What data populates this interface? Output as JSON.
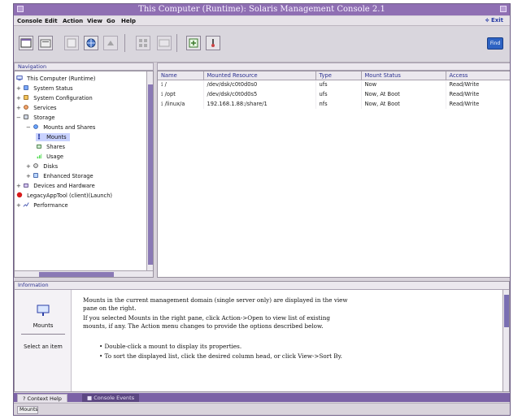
{
  "window": {
    "title": "This Computer (Runtime): Solaris Management Console 2.1"
  },
  "menu": {
    "items": [
      "Console",
      "Edit",
      "Action",
      "View",
      "Go",
      "Help"
    ],
    "exit_label": "Exit"
  },
  "toolbar": {
    "buttons": [
      "window-icon",
      "window-dim-icon",
      "open-dim-icon",
      "globe-icon",
      "up-icon",
      "grid-dim-icon",
      "panel-dim-icon",
      "properties-icon",
      "pin-icon"
    ],
    "find_label": "Find"
  },
  "navigation": {
    "header": "Navigation",
    "tree": [
      {
        "label": "This Computer (Runtime)",
        "indent": 0,
        "icon": "computer-icon"
      },
      {
        "label": "System Status",
        "indent": 0,
        "icon": "status-icon"
      },
      {
        "label": "System Configuration",
        "indent": 0,
        "icon": "config-icon"
      },
      {
        "label": "Services",
        "indent": 0,
        "icon": "services-icon"
      },
      {
        "label": "Storage",
        "indent": 0,
        "icon": "storage-icon"
      },
      {
        "label": "Mounts and Shares",
        "indent": 1,
        "icon": "mounts-icon"
      },
      {
        "label": "Mounts",
        "indent": 2,
        "icon": "mount-icon",
        "selected": true
      },
      {
        "label": "Shares",
        "indent": 2,
        "icon": "shares-icon"
      },
      {
        "label": "Usage",
        "indent": 2,
        "icon": "usage-icon"
      },
      {
        "label": "Disks",
        "indent": 1,
        "icon": "disks-icon"
      },
      {
        "label": "Enhanced Storage",
        "indent": 1,
        "icon": "enhanced-storage-icon"
      },
      {
        "label": "Devices and Hardware",
        "indent": 0,
        "icon": "devices-icon"
      },
      {
        "label": "LegacyAppTool (client)(Launch)",
        "indent": 0,
        "icon": "legacy-icon"
      },
      {
        "label": "Performance",
        "indent": 0,
        "icon": "performance-icon"
      }
    ]
  },
  "main": {
    "columns": [
      "Name",
      "Mounted Resource",
      "Type",
      "Mount Status",
      "Access"
    ],
    "rows": [
      {
        "name": "/",
        "resource": "/dev/dsk/c0t0d0s0",
        "type": "ufs",
        "status": "Now",
        "access": "Read/Write"
      },
      {
        "name": "/opt",
        "resource": "/dev/dsk/c0t0d0s5",
        "type": "ufs",
        "status": "Now, At Boot",
        "access": "Read/Write"
      },
      {
        "name": "/linux/a",
        "resource": "192.168.1.88:/share/1",
        "type": "nfs",
        "status": "Now, At Boot",
        "access": "Read/Write"
      }
    ]
  },
  "info": {
    "header": "Information",
    "icon_label": "Mounts",
    "left_action": "Select an item",
    "para1": "Mounts in the current management domain (single server only) are displayed in the view pane on the right.",
    "para2": "If you selected Mounts in the right pane, click Action->Open to view list of existing mounts, if any. The Action menu changes to provide the options described below.",
    "bullets": [
      "Double-click a mount to display its properties.",
      "To sort the displayed list, click the desired column head, or click View->Sort By."
    ]
  },
  "tabs": {
    "active": "Context Help",
    "inactive": "Console Events"
  },
  "status": {
    "text": "Mounts"
  }
}
